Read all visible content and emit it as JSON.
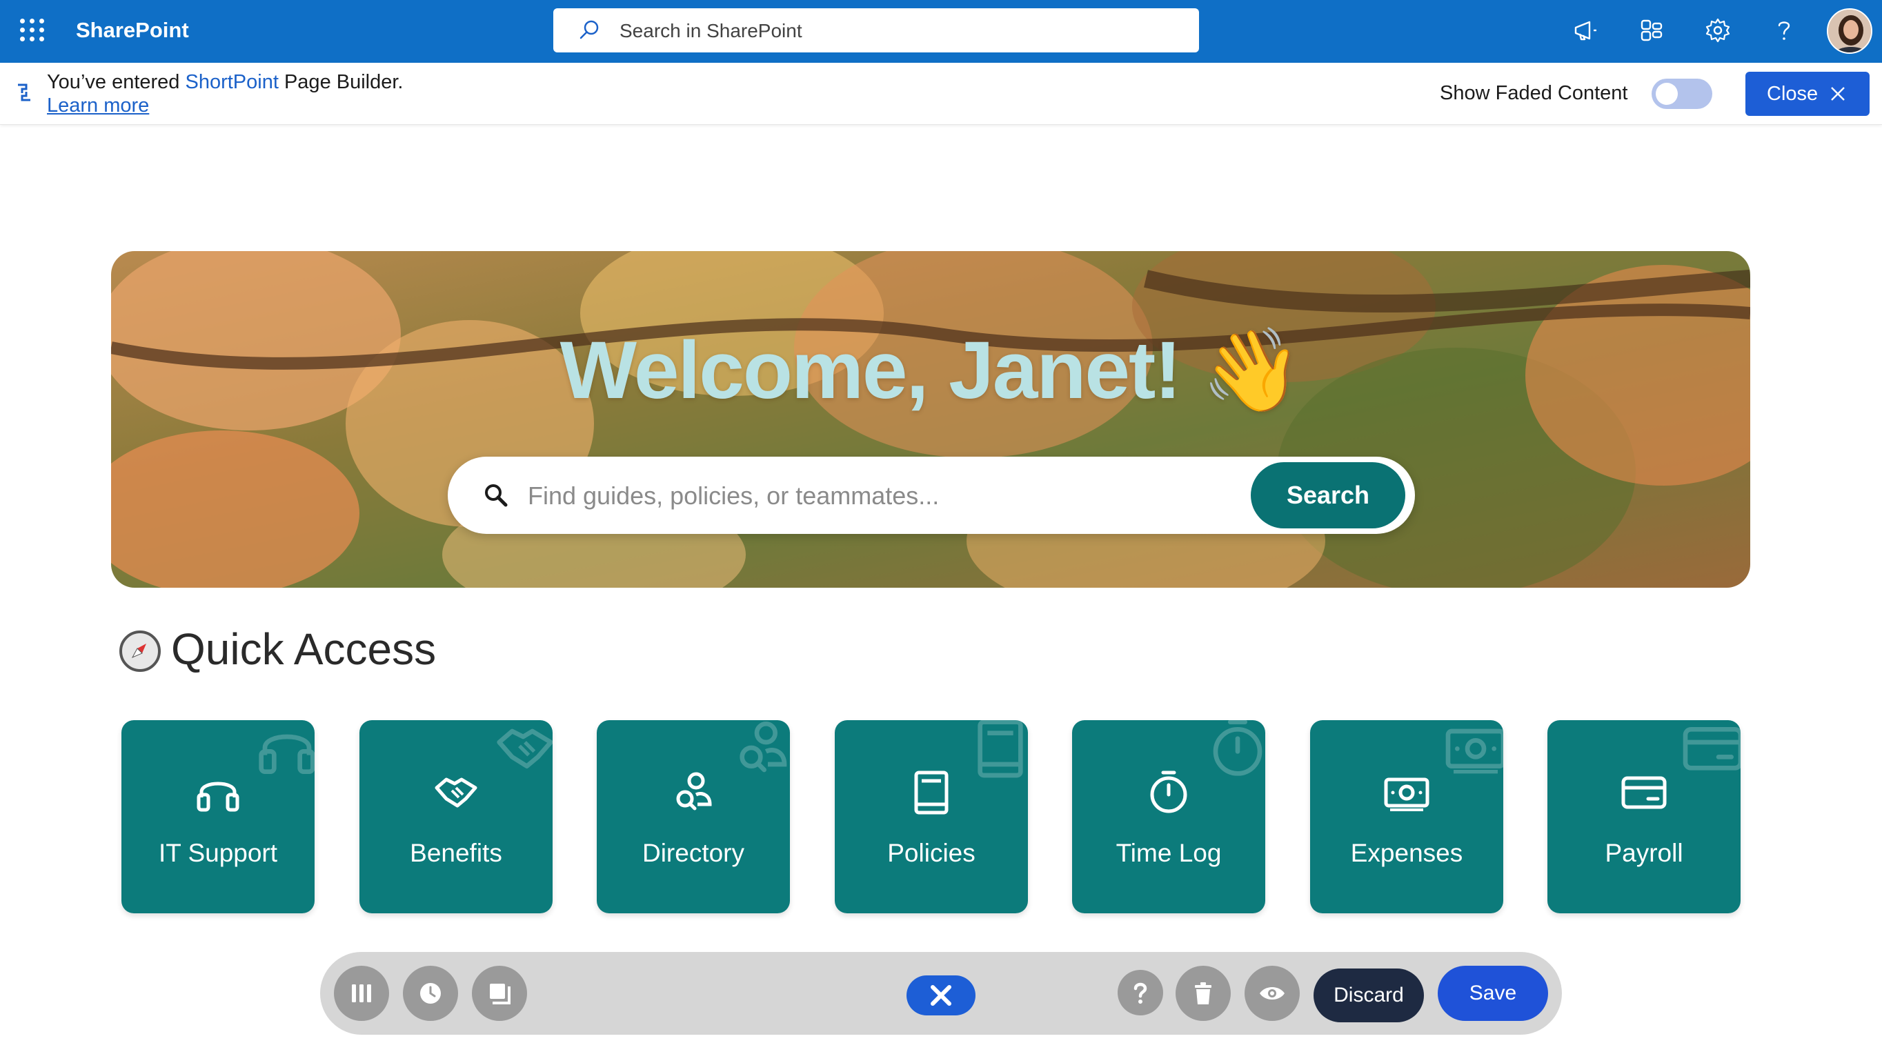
{
  "suite_bar": {
    "app_name": "SharePoint",
    "search_placeholder": "Search in SharePoint",
    "icons": [
      "app-launcher-icon",
      "megaphone-icon",
      "sharepoint-connect-icon",
      "settings-gear-icon",
      "help-icon",
      "user-avatar"
    ],
    "color": "#0f6fc6"
  },
  "notice_bar": {
    "text_before": "You’ve entered ",
    "brand": "ShortPoint",
    "text_after": " Page Builder.",
    "learn_more": "Learn more",
    "faded_label": "Show Faded Content",
    "faded_toggle_on": false,
    "close_label": "Close"
  },
  "hero": {
    "welcome": "Welcome, Janet! 👋",
    "search_placeholder": "Find guides, policies, or teammates...",
    "search_button": "Search",
    "background": "autumn-maple-leaves-photo"
  },
  "quick_access": {
    "title": "Quick Access",
    "title_icon": "compass-icon",
    "tile_color": "#0c7b7b",
    "tiles": [
      {
        "label": "IT Support",
        "icon": "headset-icon"
      },
      {
        "label": "Benefits",
        "icon": "handshake-icon"
      },
      {
        "label": "Directory",
        "icon": "people-search-icon"
      },
      {
        "label": "Policies",
        "icon": "book-icon"
      },
      {
        "label": "Time Log",
        "icon": "stopwatch-icon"
      },
      {
        "label": "Expenses",
        "icon": "money-icon"
      },
      {
        "label": "Payroll",
        "icon": "credit-card-icon"
      }
    ]
  },
  "toolbar": {
    "left_buttons": [
      "columns-icon",
      "history-icon",
      "copy-icon"
    ],
    "exit_icon": "close-icon",
    "right_icons": [
      "help-icon",
      "trash-icon",
      "preview-eye-icon"
    ],
    "discard": "Discard",
    "save": "Save"
  }
}
